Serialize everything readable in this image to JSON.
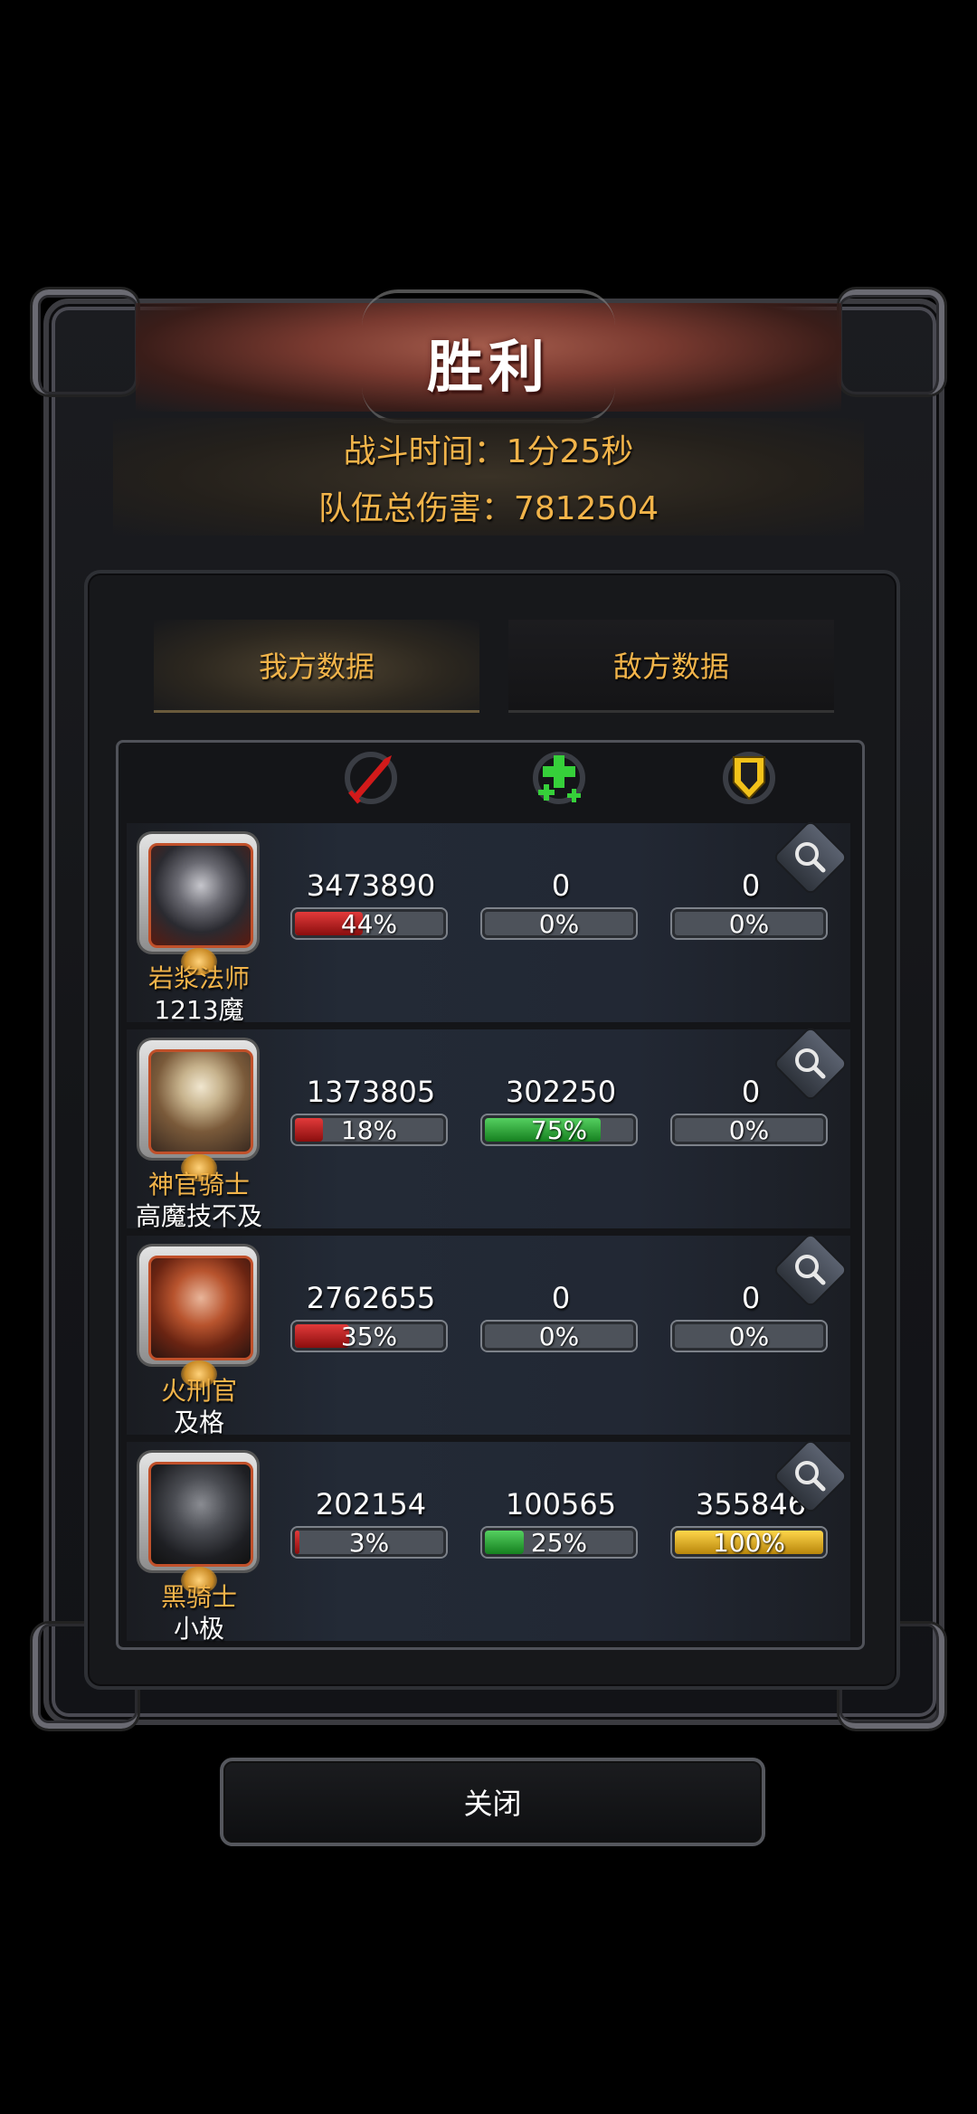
{
  "title": "胜利",
  "summary": {
    "battle_time": "战斗时间：1分25秒",
    "total_damage": "队伍总伤害：7812504"
  },
  "tabs": {
    "ours": "我方数据",
    "enemy": "敌方数据"
  },
  "column_icons": [
    "damage-sword-icon",
    "heal-cross-icon",
    "shield-icon"
  ],
  "colors": {
    "accent": "#f2b44a",
    "damage": "#c81414",
    "heal": "#1fa22b",
    "tank": "#e2b218"
  },
  "rows": [
    {
      "hero": "岩浆法师",
      "player": "1213魔",
      "damage": "3473890",
      "damage_pct": "44%",
      "heal": "0",
      "heal_pct": "0%",
      "tank": "0",
      "tank_pct": "0%"
    },
    {
      "hero": "神官骑士",
      "player": "高魔技不及",
      "damage": "1373805",
      "damage_pct": "18%",
      "heal": "302250",
      "heal_pct": "75%",
      "tank": "0",
      "tank_pct": "0%"
    },
    {
      "hero": "火刑官",
      "player": "及格",
      "damage": "2762655",
      "damage_pct": "35%",
      "heal": "0",
      "heal_pct": "0%",
      "tank": "0",
      "tank_pct": "0%"
    },
    {
      "hero": "黑骑士",
      "player": "小极",
      "damage": "202154",
      "damage_pct": "3%",
      "heal": "100565",
      "heal_pct": "25%",
      "tank": "355846",
      "tank_pct": "100%"
    }
  ],
  "close_label": "关闭"
}
